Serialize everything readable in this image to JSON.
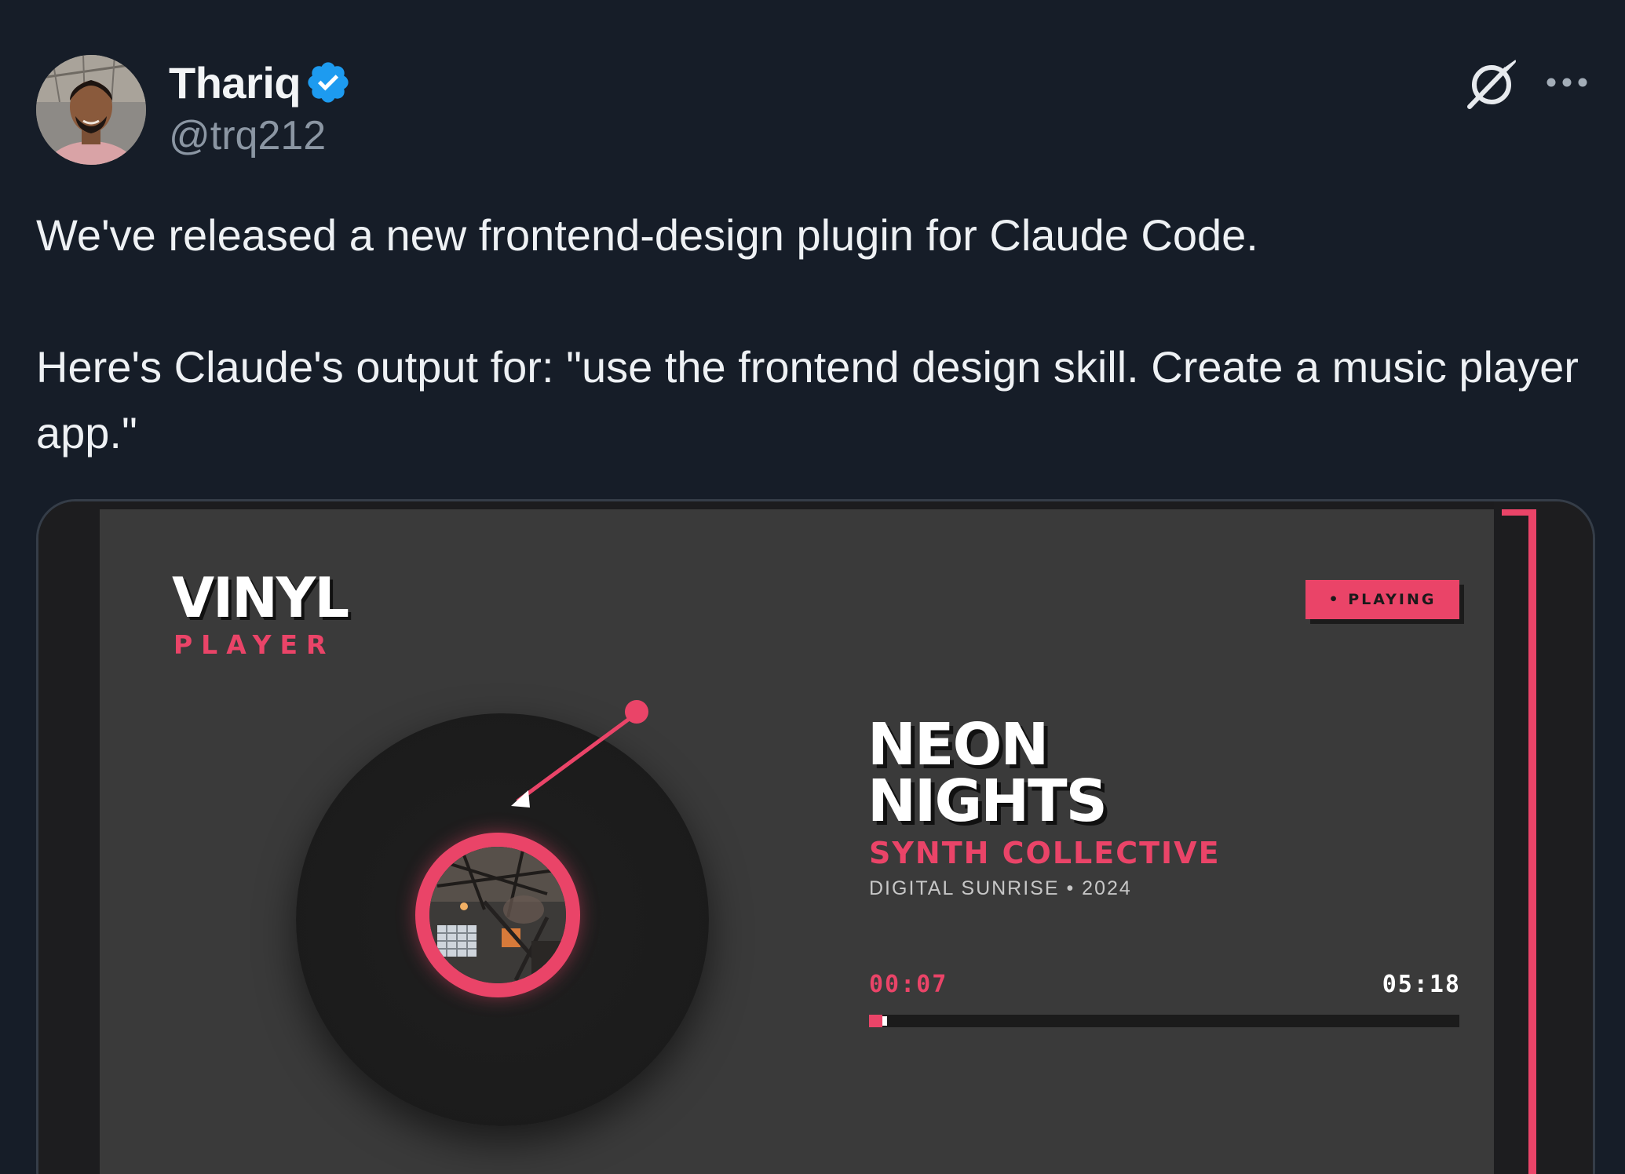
{
  "tweet": {
    "author_name": "Thariq",
    "author_handle": "@trq212",
    "verified": true,
    "text_line1": "We've released a new frontend-design plugin for Claude Code.",
    "text_line2": "Here's Claude's output for: \"use the frontend design skill. Create a music player app.\""
  },
  "header_icons": [
    "grok-icon",
    "more-icon"
  ],
  "media": {
    "app": {
      "logo_title": "VINYL",
      "logo_subtitle": "PLAYER",
      "status_badge": "• PLAYING",
      "track_title_line1": "NEON",
      "track_title_line2": "NIGHTS",
      "artist": "SYNTH COLLECTIVE",
      "album_meta": "DIGITAL SUNRISE • 2024",
      "time_elapsed": "00:07",
      "time_total": "05:18",
      "progress_fraction": 0.022
    }
  },
  "colors": {
    "background": "#161d28",
    "accent": "#ea4468",
    "app_surface": "#3a3a3a",
    "verified": "#1d9bf0",
    "text_primary": "#eef1f4",
    "text_secondary": "#8b96a3"
  }
}
